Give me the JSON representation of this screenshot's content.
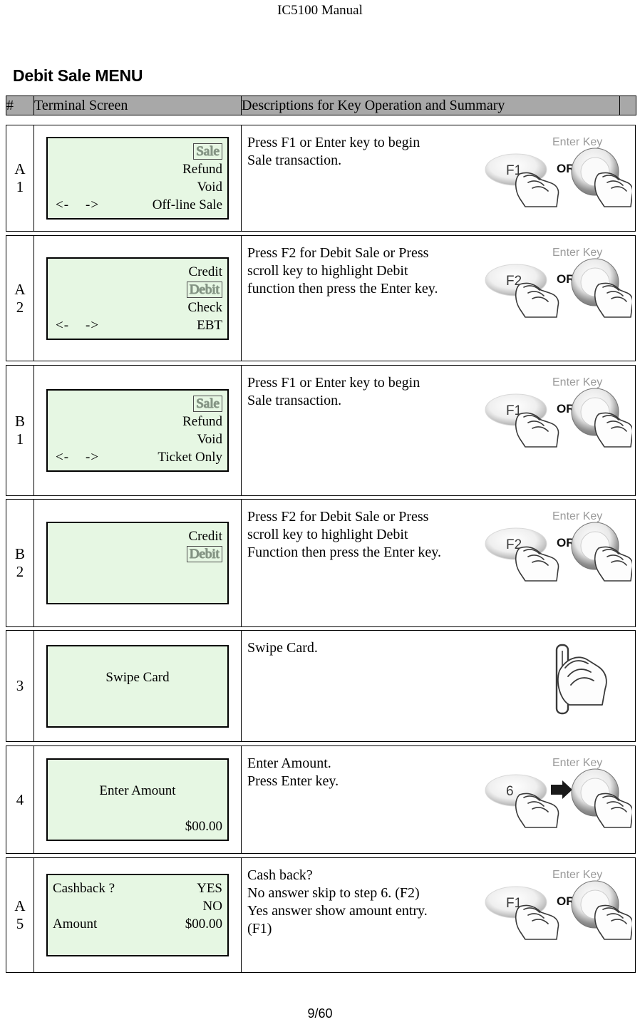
{
  "document": {
    "header_title": "IC5100 Manual",
    "section_title": "Debit Sale MENU",
    "footer": "9/60"
  },
  "table": {
    "columns": [
      "#",
      "Terminal Screen",
      "Descriptions for Key Operation and Summary",
      ""
    ],
    "rows": [
      {
        "id": "A1",
        "num_line1": "A",
        "num_line2": "1",
        "screen": {
          "lines": [
            {
              "type": "right",
              "text": "Sale",
              "highlighted": true
            },
            {
              "type": "right",
              "text": "Refund"
            },
            {
              "type": "right",
              "text": "Void"
            },
            {
              "type": "arrows",
              "left": "<-    ->",
              "text": "Off-line Sale"
            }
          ]
        },
        "description": "Press F1 or Enter key to begin\nSale transaction.",
        "art": {
          "kind": "key-or-enter",
          "fkey": "F1",
          "connector": "OR",
          "enter_label": "Enter Key"
        }
      },
      {
        "id": "A2",
        "num_line1": "A",
        "num_line2": "2",
        "screen": {
          "lines": [
            {
              "type": "right",
              "text": "Credit"
            },
            {
              "type": "right",
              "text": "Debit",
              "highlighted": true
            },
            {
              "type": "right",
              "text": "Check"
            },
            {
              "type": "arrows",
              "left": "<-    ->",
              "text": "EBT"
            }
          ]
        },
        "description": "Press F2 for Debit Sale or Press\nscroll key to highlight Debit\nfunction then press the Enter key.",
        "art": {
          "kind": "key-or-enter",
          "fkey": "F2",
          "connector": "OR",
          "enter_label": "Enter Key"
        }
      },
      {
        "id": "B1",
        "num_line1": "B",
        "num_line2": "1",
        "screen": {
          "lines": [
            {
              "type": "right",
              "text": "Sale",
              "highlighted": true
            },
            {
              "type": "right",
              "text": "Refund"
            },
            {
              "type": "right",
              "text": "Void"
            },
            {
              "type": "arrows",
              "left": "<-    ->",
              "text": "Ticket Only"
            }
          ]
        },
        "description": "Press F1 or Enter key to begin\nSale transaction.",
        "art": {
          "kind": "key-or-enter",
          "fkey": "F1",
          "connector": "OR",
          "enter_label": "Enter Key"
        }
      },
      {
        "id": "B2",
        "num_line1": "B",
        "num_line2": "2",
        "screen": {
          "lines": [
            {
              "type": "right",
              "text": "Credit"
            },
            {
              "type": "right",
              "text": "Debit",
              "highlighted": true
            },
            {
              "type": "blank",
              "text": ""
            },
            {
              "type": "blank",
              "text": ""
            }
          ]
        },
        "description": "Press F2 for Debit Sale or Press\nscroll key to highlight Debit\nFunction then press the Enter key.",
        "art": {
          "kind": "key-or-enter",
          "fkey": "F2",
          "connector": "OR",
          "enter_label": "Enter Key"
        }
      },
      {
        "id": "3",
        "num_line1": "3",
        "num_line2": "",
        "screen": {
          "lines": [
            {
              "type": "blank",
              "text": ""
            },
            {
              "type": "center",
              "text": "Swipe Card"
            },
            {
              "type": "blank",
              "text": ""
            },
            {
              "type": "blank",
              "text": ""
            }
          ]
        },
        "description": "Swipe Card.",
        "art": {
          "kind": "swipe-card"
        }
      },
      {
        "id": "4",
        "num_line1": "4",
        "num_line2": "",
        "screen": {
          "lines": [
            {
              "type": "blank",
              "text": ""
            },
            {
              "type": "center",
              "text": "Enter Amount"
            },
            {
              "type": "blank",
              "text": ""
            },
            {
              "type": "right",
              "text": "$00.00"
            }
          ]
        },
        "description": "Enter Amount.\nPress Enter key.",
        "art": {
          "kind": "key-then-enter",
          "fkey": "6",
          "connector": "arrow",
          "enter_label": "Enter Key"
        }
      },
      {
        "id": "A5",
        "num_line1": "A",
        "num_line2": "5",
        "screen": {
          "lines": [
            {
              "type": "split",
              "left": "Cashback ?",
              "text": "YES"
            },
            {
              "type": "right",
              "text": "NO"
            },
            {
              "type": "split",
              "left": "Amount",
              "text": "$00.00"
            },
            {
              "type": "blank",
              "text": ""
            }
          ]
        },
        "description": "Cash back?\nNo answer skip to step 6. (F2)\nYes answer show amount entry.\n (F1)",
        "art": {
          "kind": "key-or-enter",
          "fkey": "F1",
          "connector": "OR",
          "enter_label": "Enter Key"
        }
      }
    ]
  },
  "colors": {
    "header_fill": "#a8a8a8",
    "lcd_fill": "#e6f7e3",
    "border": "#000000"
  }
}
